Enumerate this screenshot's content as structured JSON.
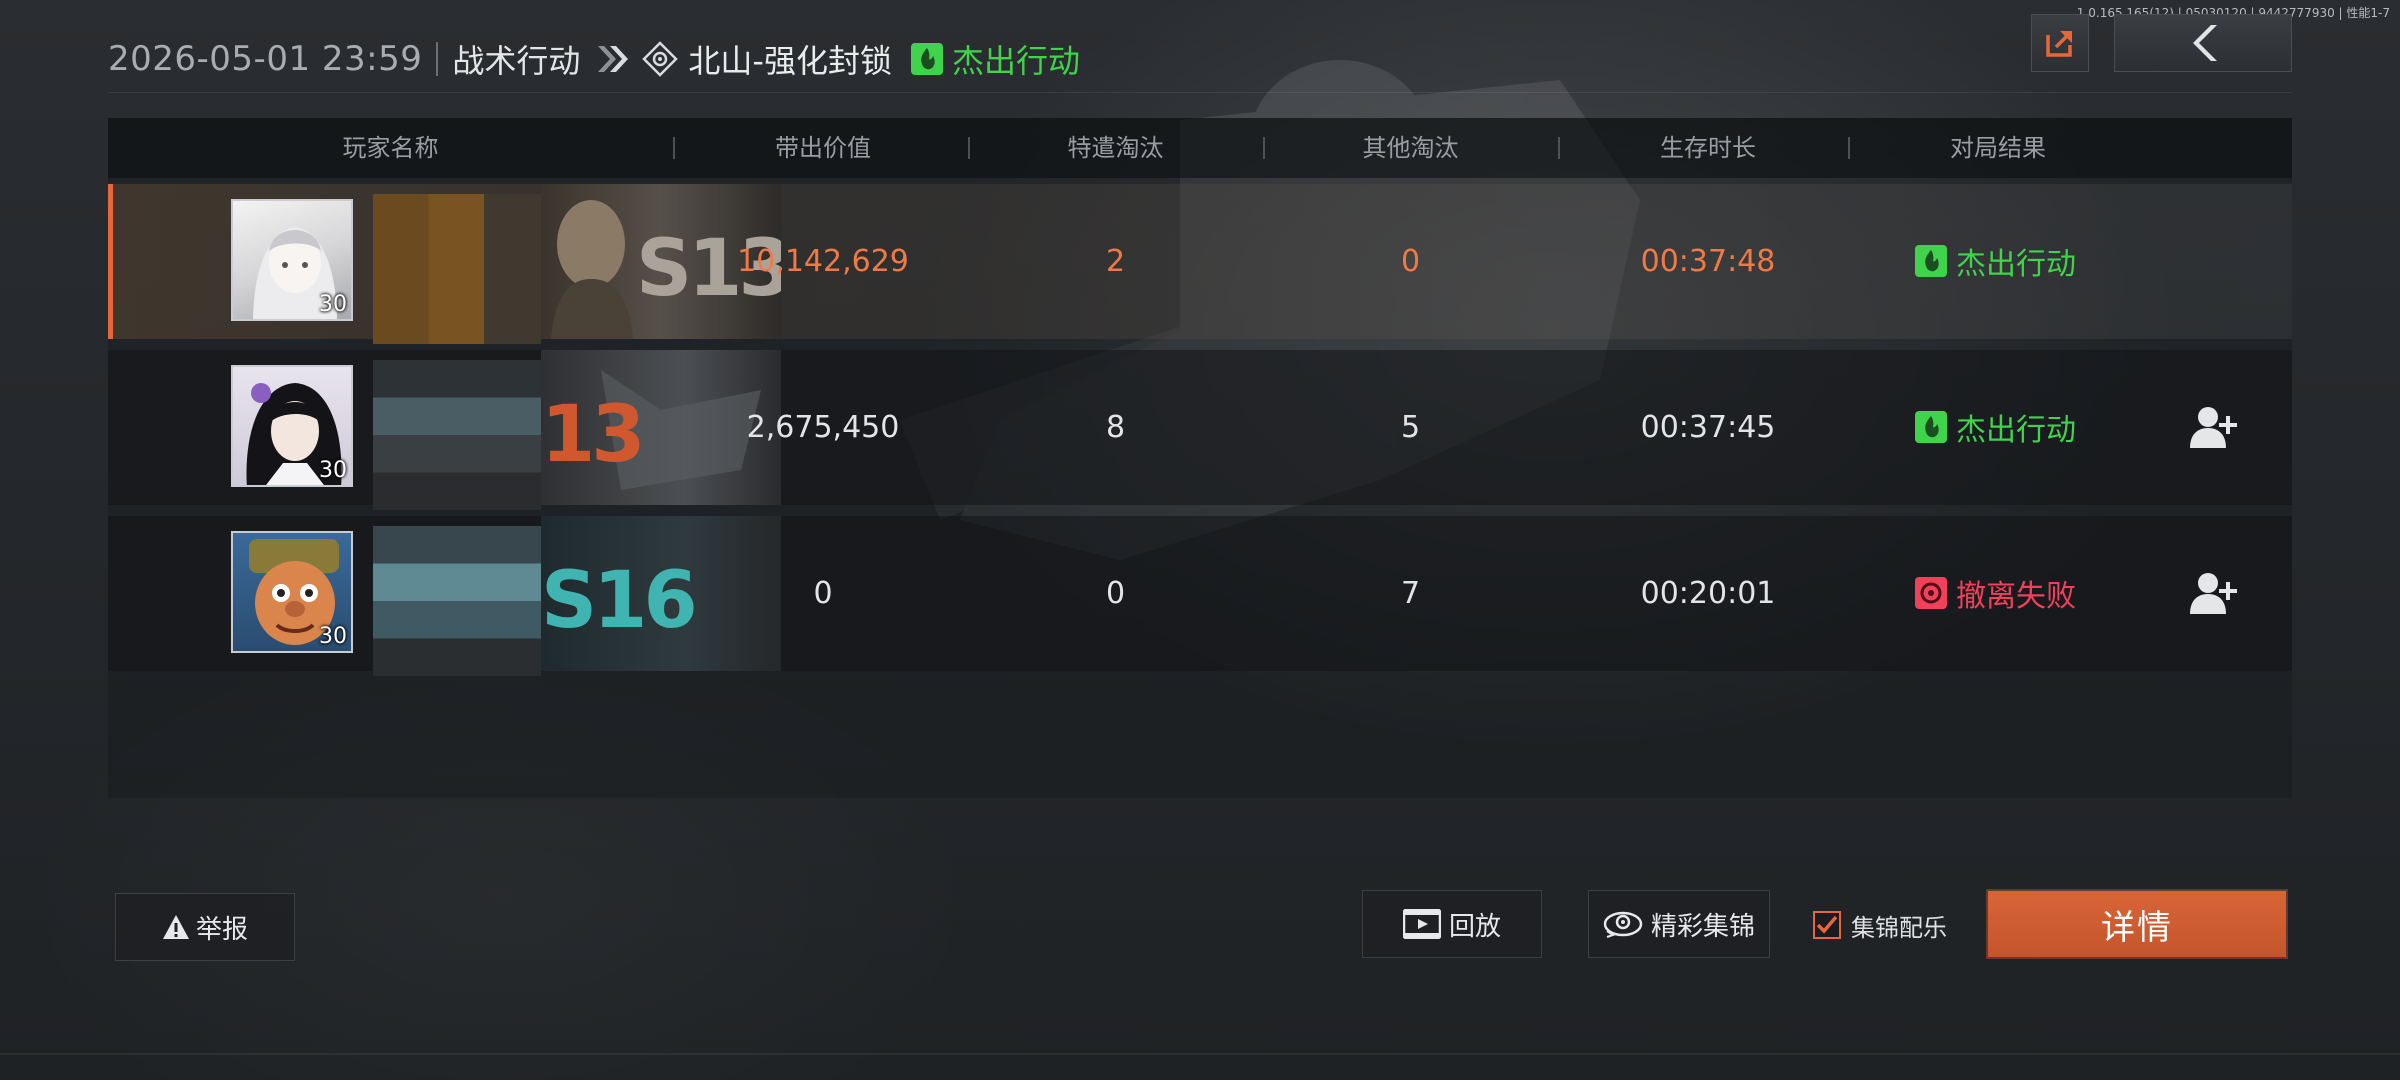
{
  "perf_info": "1.0.165.165(12) | 05030120 | 9442777930 | 性能1-7",
  "header": {
    "datetime": "2026-05-01 23:59",
    "mode": "战术行动",
    "map": "北山-强化封锁",
    "result": "杰出行动",
    "result_color": "#3fd44b"
  },
  "toolbar": {
    "share_icon": "share-icon",
    "back_icon": "chevron-left-icon"
  },
  "table": {
    "columns": [
      "玩家名称",
      "带出价值",
      "特遣淘汰",
      "其他淘汰",
      "生存时长",
      "对局结果"
    ],
    "rows": [
      {
        "level": "30",
        "season_badge": "S13",
        "value": "10,142,629",
        "task_kills": "2",
        "other_kills": "0",
        "survival_time": "00:37:48",
        "result": "杰出行动",
        "result_type": "success",
        "highlighted": true
      },
      {
        "level": "30",
        "season_badge": "13",
        "value": "2,675,450",
        "task_kills": "8",
        "other_kills": "5",
        "survival_time": "00:37:45",
        "result": "杰出行动",
        "result_type": "success",
        "add_friend_icon": "add-friend-icon"
      },
      {
        "level": "30",
        "season_badge": "S16",
        "value": "0",
        "task_kills": "0",
        "other_kills": "7",
        "survival_time": "00:20:01",
        "result": "撤离失败",
        "result_type": "failure",
        "add_friend_icon": "add-friend-icon"
      }
    ]
  },
  "buttons": {
    "report": "举报",
    "replay": "回放",
    "highlights": "精彩集锦",
    "highlight_music": "集锦配乐",
    "highlight_music_checked": true,
    "details": "详情"
  },
  "colors": {
    "accent": "#e8673a",
    "success": "#3fd44b",
    "failure": "#f0405a"
  }
}
